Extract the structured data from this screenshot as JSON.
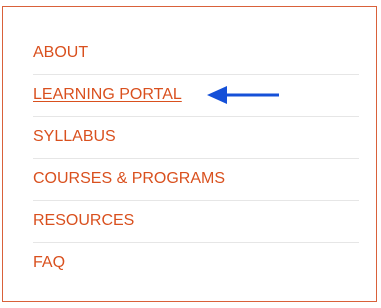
{
  "menu": {
    "items": [
      {
        "label": "ABOUT"
      },
      {
        "label": "LEARNING PORTAL",
        "active": true
      },
      {
        "label": "SYLLABUS"
      },
      {
        "label": "COURSES & PROGRAMS"
      },
      {
        "label": "RESOURCES"
      },
      {
        "label": "FAQ"
      }
    ]
  },
  "colors": {
    "link": "#d9501e",
    "border": "#d9613a",
    "divider": "#e6e6e6",
    "arrow": "#1550d8"
  },
  "annotation": {
    "icon": "arrow-left-icon",
    "points_to": "LEARNING PORTAL"
  }
}
